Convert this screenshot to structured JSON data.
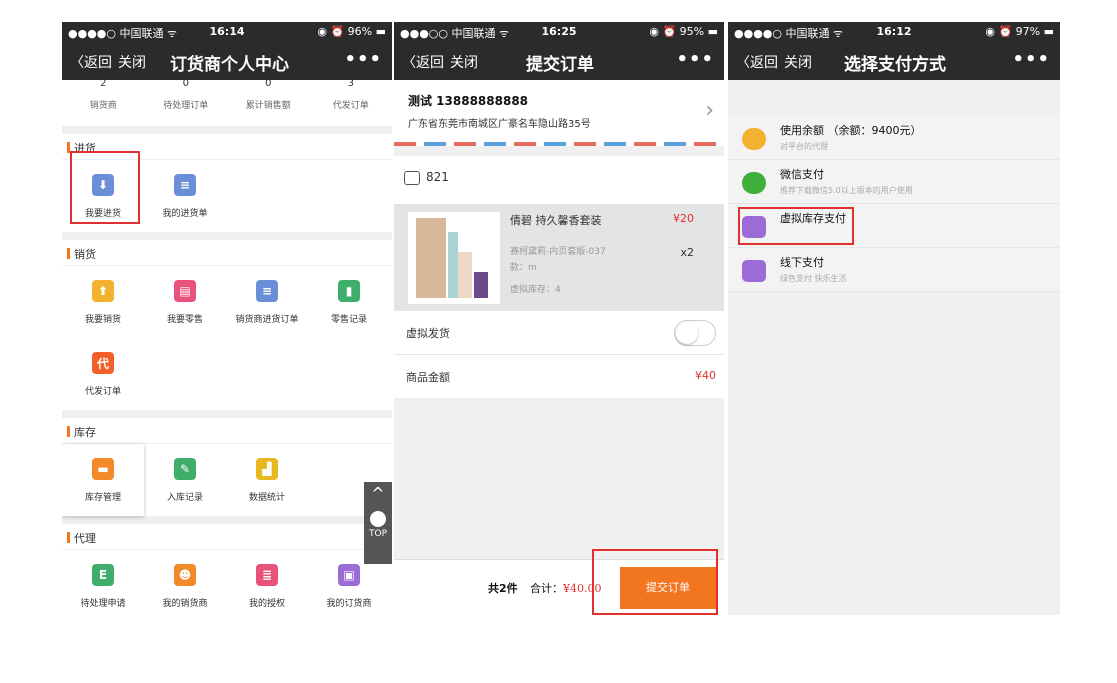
{
  "panel1": {
    "status": {
      "signal": "●●●●○ 中国联通 ᯤ",
      "time": "16:14",
      "battery": "◉ ⏰ 96% ▬"
    },
    "nav": {
      "back": "〈返回",
      "close": "关闭",
      "title": "订货商个人中心",
      "more": "•••"
    },
    "stats": [
      {
        "num": "2",
        "label": "销货商"
      },
      {
        "num": "0",
        "label": "待处理订单"
      },
      {
        "num": "0",
        "label": "累计销售额"
      },
      {
        "num": "3",
        "label": "代发订单"
      }
    ],
    "sections": {
      "purchase": {
        "title": "进货",
        "items": [
          "我要进货",
          "我的进货单"
        ]
      },
      "sales": {
        "title": "销货",
        "items": [
          "我要销货",
          "我要零售",
          "销货商进货订单",
          "零售记录",
          "代发订单"
        ],
        "badge_char": "代"
      },
      "stock": {
        "title": "库存",
        "items": [
          "库存管理",
          "入库记录",
          "数据统计"
        ]
      },
      "agent": {
        "title": "代理",
        "items": [
          "待处理申请",
          "我的销货商",
          "我的授权",
          "我的订货商"
        ]
      }
    },
    "fab": {
      "up": "^",
      "top": "TOP"
    }
  },
  "panel2": {
    "status": {
      "signal": "●●●○○ 中国联通 ᯤ",
      "time": "16:25",
      "battery": "◉ ⏰ 95% ▬"
    },
    "nav": {
      "back": "〈返回",
      "close": "关闭",
      "title": "提交订单",
      "more": "•••"
    },
    "address": {
      "name": "测试 13888888888",
      "line": "广东省东莞市南城区广豪名车隐山路35号"
    },
    "shop": {
      "id": "821"
    },
    "product": {
      "name": "倩碧 持久馨香套装",
      "price": "¥20",
      "qty": "x2",
      "spec": "赛柯黛莉-内页套版-037",
      "model": "款：m",
      "stock": "虚拟库存：4"
    },
    "virtual_ship": "虚拟发货",
    "amount_label": "商品金额",
    "amount": "¥40",
    "footer": {
      "count": "共2件",
      "total_label": "合计：",
      "total": "¥40.00",
      "submit": "提交订单"
    }
  },
  "panel3": {
    "status": {
      "signal": "●●●●○ 中国联通 ᯤ",
      "time": "16:12",
      "battery": "◉ ⏰ 97% ▬"
    },
    "nav": {
      "back": "〈返回",
      "close": "关闭",
      "title": "选择支付方式",
      "more": "•••"
    },
    "methods": [
      {
        "name": "使用余额 （余额：9400元）",
        "desc": "对平台的代理"
      },
      {
        "name": "微信支付",
        "desc": "推荐下载微信5.0以上版本的用户使用"
      },
      {
        "name": "虚拟库存支付",
        "desc": ""
      },
      {
        "name": "线下支付",
        "desc": "绿色支付 快乐生活"
      }
    ]
  },
  "colors": {
    "accent": "#f27520",
    "navbar": "#2b2b2b",
    "highlight": "#e03030",
    "price": "#e03030"
  }
}
